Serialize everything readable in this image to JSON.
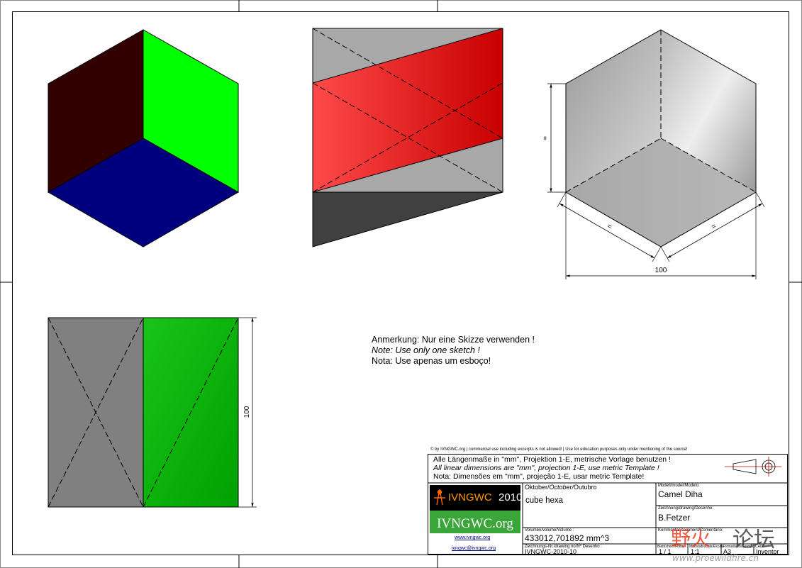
{
  "views": {
    "top_left": {
      "faces": {
        "left": "#320000",
        "right": "#00ff00",
        "bottom": "#00007f"
      }
    },
    "top_middle": {
      "faces": {
        "band": "#e00000",
        "background": "#a8a8a8",
        "bottom": "#404040"
      }
    },
    "top_right": {
      "dimensions": {
        "vertical": "=",
        "lower_left": "=",
        "lower_right": "=",
        "width": "100"
      }
    },
    "bottom_left": {
      "faces": {
        "left": "#808080",
        "right": "#00b000"
      },
      "dimension_height": "100"
    }
  },
  "note": {
    "line_de": "Anmerkung: Nur eine Skizze verwenden !",
    "line_en": "Note: Use only one sketch !",
    "line_pt": "Nota: Use apenas um esboço!"
  },
  "title_block": {
    "copyright": "© by IVNGWC.org | commercial use including excerpts is not allowed! | Use for education purposes only under mentioning of the source!",
    "units_de": "Alle Längenmaße in \"mm\", Projektion 1-E, metrische Vorlage benutzen !",
    "units_en": "All linear dimensions are \"mm\", projection 1-E, use metric Template !",
    "units_pt": "Nota: Dimensões em \"mm\", projeção 1-E, usar metric Template!",
    "logo_text": "IVNGWC",
    "logo_year": "2010",
    "logo_org": "IVNGWC.org",
    "website": "www.ivngwc.org",
    "email": "ivngwc@ivngwc.org",
    "month_label_1": "Oktober/",
    "month_label_2": "October/",
    "month_label_3": "Outubro",
    "part_name": "cube hexa",
    "model_label": "Modell/model/Modelo:",
    "model_value": "Camel Diha",
    "drawing_label": "Zeichnung/drawing/Desenho:",
    "drawing_value": "B.Fetzer",
    "comment_label": "Kommentar/comment/Comentário:",
    "volume_label": "Volumen/volume/Volume :",
    "volume_value": "433012,701892 mm^3",
    "drawing_no_label": "Zeichnungs-Nr./drawing no/Nº Desenho :",
    "drawing_no_value": "IVNGWC-2010-10",
    "sheet_label": "Blatt/sheet/Folha",
    "sheet_value": "1 / 1",
    "scale_label": "Maßstab/scale/Escala",
    "scale_value": "1:1",
    "format_label": "Format/size/Formato",
    "format_value": "A3",
    "cad_label": "CAD:",
    "cad_value": "Inventor"
  },
  "watermark": {
    "text_left": "野火",
    "text_right": "论坛",
    "url": "www.proewildfire.cn"
  }
}
